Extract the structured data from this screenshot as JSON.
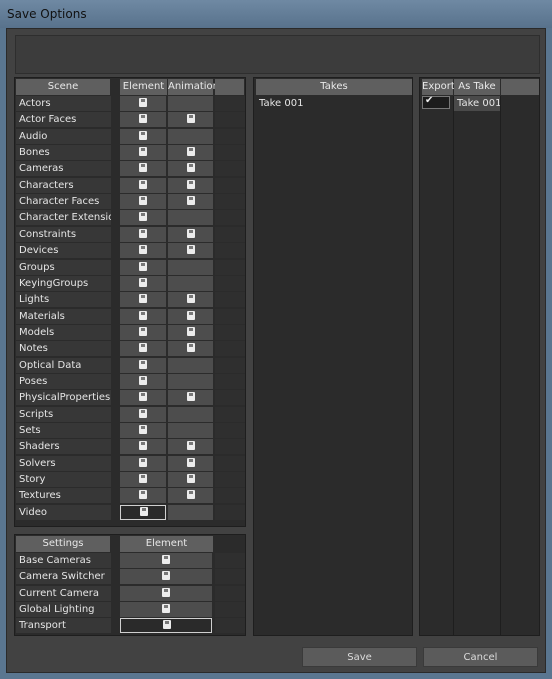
{
  "window": {
    "title": "Save Options"
  },
  "scene": {
    "header": "Scene",
    "element_header": "Element",
    "animation_header": "Animation",
    "rows": [
      {
        "label": "Actors",
        "element": true,
        "animation": false
      },
      {
        "label": "Actor Faces",
        "element": true,
        "animation": true
      },
      {
        "label": "Audio",
        "element": true,
        "animation": false
      },
      {
        "label": "Bones",
        "element": true,
        "animation": true
      },
      {
        "label": "Cameras",
        "element": true,
        "animation": true
      },
      {
        "label": "Characters",
        "element": true,
        "animation": true
      },
      {
        "label": "Character Faces",
        "element": true,
        "animation": true
      },
      {
        "label": "Character Extensio...",
        "element": true,
        "animation": false
      },
      {
        "label": "Constraints",
        "element": true,
        "animation": true
      },
      {
        "label": "Devices",
        "element": true,
        "animation": true
      },
      {
        "label": "Groups",
        "element": true,
        "animation": false
      },
      {
        "label": "KeyingGroups",
        "element": true,
        "animation": false
      },
      {
        "label": "Lights",
        "element": true,
        "animation": true
      },
      {
        "label": "Materials",
        "element": true,
        "animation": true
      },
      {
        "label": "Models",
        "element": true,
        "animation": true
      },
      {
        "label": "Notes",
        "element": true,
        "animation": true
      },
      {
        "label": "Optical Data",
        "element": true,
        "animation": false
      },
      {
        "label": "Poses",
        "element": true,
        "animation": false
      },
      {
        "label": "PhysicalProperties",
        "element": true,
        "animation": true
      },
      {
        "label": "Scripts",
        "element": true,
        "animation": false
      },
      {
        "label": "Sets",
        "element": true,
        "animation": false
      },
      {
        "label": "Shaders",
        "element": true,
        "animation": true
      },
      {
        "label": "Solvers",
        "element": true,
        "animation": true
      },
      {
        "label": "Story",
        "element": true,
        "animation": true
      },
      {
        "label": "Textures",
        "element": true,
        "animation": true
      },
      {
        "label": "Video",
        "element": true,
        "animation": false
      }
    ]
  },
  "settings": {
    "header": "Settings",
    "element_header": "Element",
    "rows": [
      {
        "label": "Base Cameras",
        "element": true
      },
      {
        "label": "Camera Switcher",
        "element": true
      },
      {
        "label": "Current Camera",
        "element": true
      },
      {
        "label": "Global Lighting",
        "element": true
      },
      {
        "label": "Transport",
        "element": true
      }
    ]
  },
  "takes": {
    "header": "Takes",
    "items": [
      "Take 001"
    ]
  },
  "export": {
    "export_header": "Export",
    "as_take_header": "As Take ...",
    "rows": [
      {
        "checked": true,
        "as_take": "Take 001"
      }
    ]
  },
  "buttons": {
    "save": "Save",
    "cancel": "Cancel"
  },
  "selected": {
    "scene_row": "Video",
    "settings_row": "Transport"
  }
}
